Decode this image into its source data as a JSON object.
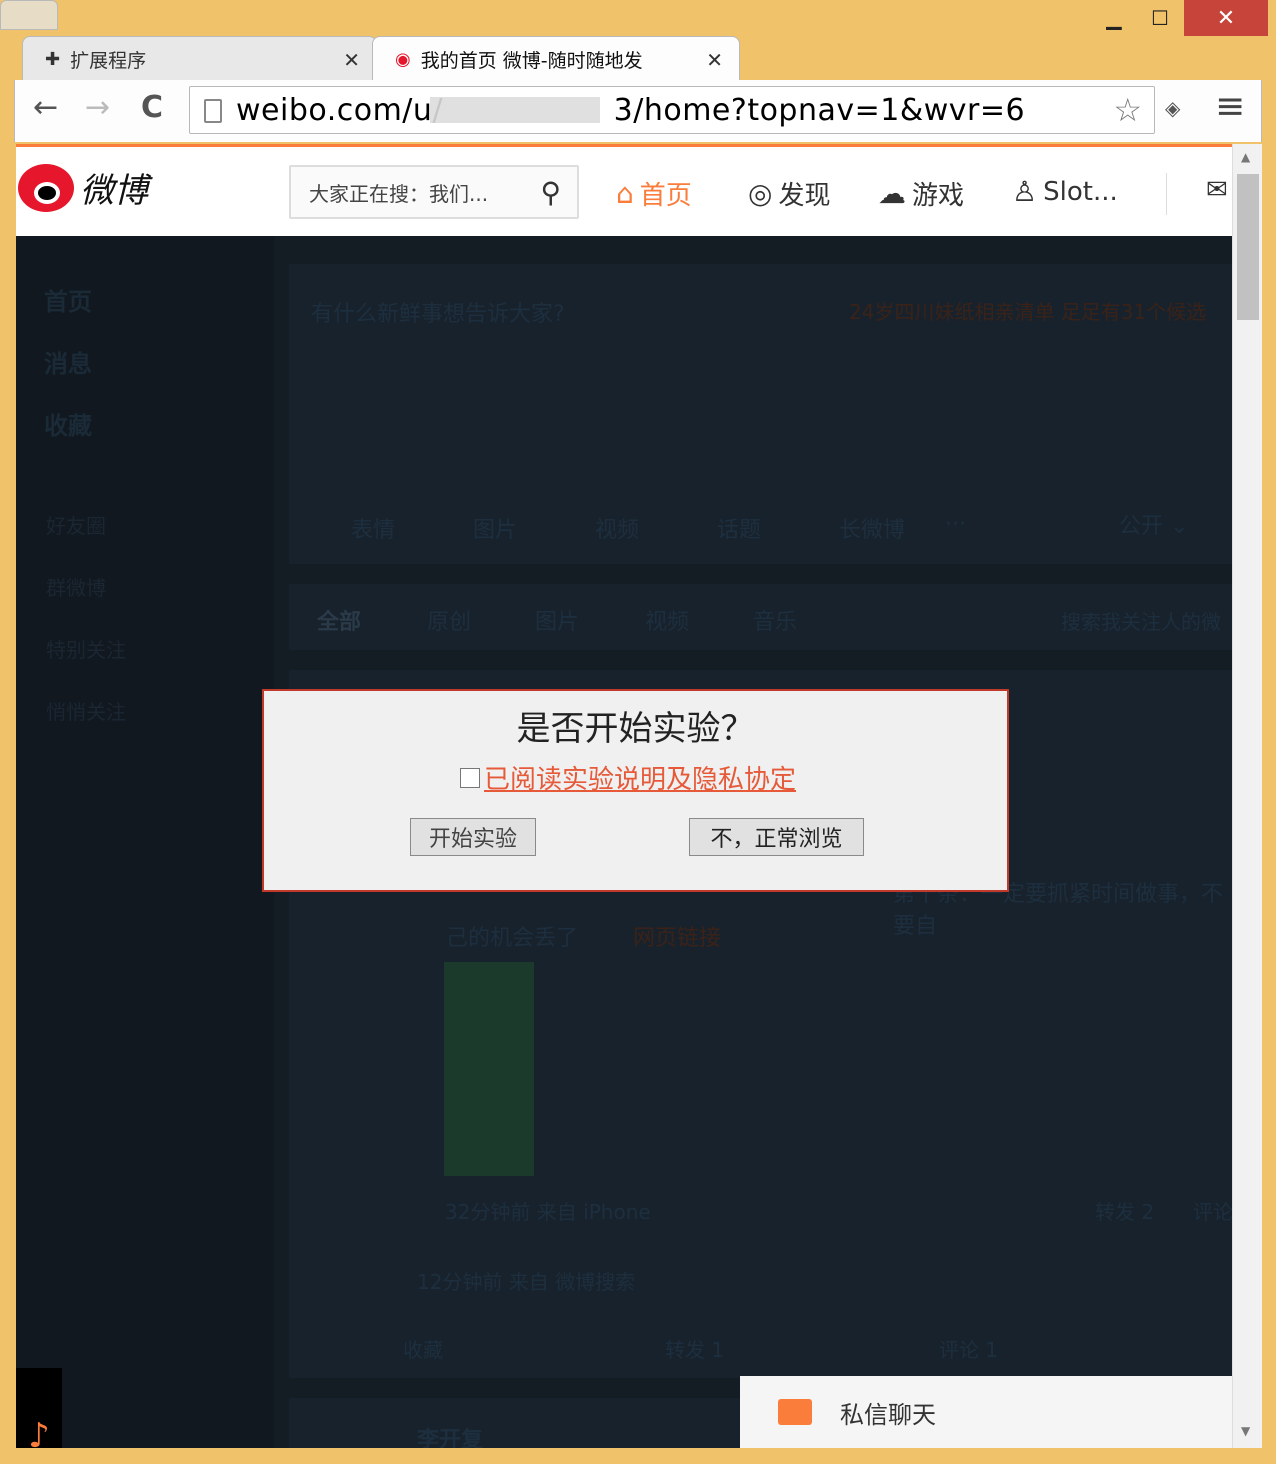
{
  "window": {
    "minimize": "▁",
    "maximize": "☐",
    "close": "✕"
  },
  "tabs": [
    {
      "title": "扩展程序",
      "close": "✕"
    },
    {
      "title": "我的首页 微博-随时随地发",
      "close": "✕"
    }
  ],
  "toolbar": {
    "back": "←",
    "forward": "→",
    "reload": "C",
    "url": "weibo.com/u/                 3/home?topnav=1&wvr=6",
    "star": "☆",
    "menu": "≡"
  },
  "header": {
    "logo_text": "微博",
    "search_placeholder": "大家正在搜：我们...",
    "nav": [
      "首页",
      "发现",
      "游戏",
      "Slot..."
    ]
  },
  "sidebar": {
    "items": [
      "首页",
      "消息",
      "收藏"
    ],
    "groups": [
      "好友圈",
      "群微博",
      "特别关注",
      "悄悄关注"
    ]
  },
  "composer": {
    "prompt": "有什么新鲜事想告诉大家?",
    "hot": "24岁四川妹纸相亲清单 足足有31个候选",
    "tools": [
      "表情",
      "图片",
      "视频",
      "话题",
      "长微博",
      "···"
    ],
    "visibility": "公开 ⌄"
  },
  "filters": {
    "tabs": [
      "全部",
      "原创",
      "图片",
      "视频",
      "音乐"
    ],
    "search_placeholder": "搜索我关注人的微"
  },
  "feed": {
    "snippet_1": "第十条：一定要抓紧时间做事，不要自",
    "snippet_2": "己的机会丢了",
    "link_label": "网页链接",
    "meta_1": "32分钟前 来自 iPhone",
    "repost_1": "转发 2",
    "comment_1": "评论",
    "meta_2": "12分钟前 来自 微博搜索",
    "actions": [
      "收藏",
      "转发 1",
      "评论 1"
    ],
    "next_user": "李开复"
  },
  "chat": {
    "label": "私信聊天"
  },
  "dialog": {
    "title": "是否开始实验？",
    "agree_link": "已阅读实验说明及隐私协定",
    "start_button": "开始实验",
    "decline_button": "不，正常浏览"
  }
}
